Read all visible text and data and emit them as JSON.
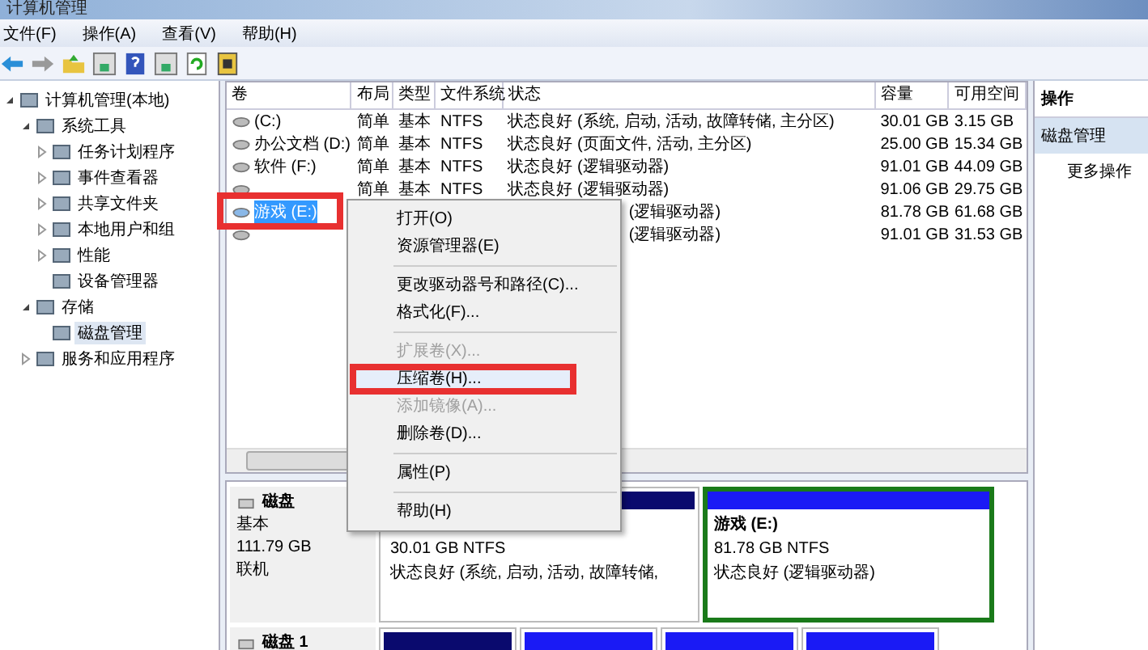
{
  "window": {
    "title": "计算机管理"
  },
  "menu": [
    "文件(F)",
    "操作(A)",
    "查看(V)",
    "帮助(H)"
  ],
  "tree": [
    {
      "label": "计算机管理(本地)",
      "expanded": true,
      "selected": false,
      "children": [
        {
          "label": "系统工具",
          "expanded": true,
          "selected": false,
          "children": [
            {
              "label": "任务计划程序",
              "expanded": false,
              "selected": false
            },
            {
              "label": "事件查看器",
              "expanded": false,
              "selected": false
            },
            {
              "label": "共享文件夹",
              "expanded": false,
              "selected": false
            },
            {
              "label": "本地用户和组",
              "expanded": false,
              "selected": false
            },
            {
              "label": "性能",
              "expanded": false,
              "selected": false
            },
            {
              "label": "设备管理器",
              "selected": false
            }
          ]
        },
        {
          "label": "存储",
          "expanded": true,
          "selected": false,
          "children": [
            {
              "label": "磁盘管理",
              "selected": true
            }
          ]
        },
        {
          "label": "服务和应用程序",
          "expanded": false,
          "selected": false
        }
      ]
    }
  ],
  "table": {
    "columns": [
      "卷",
      "布局",
      "类型",
      "文件系统",
      "状态",
      "容量",
      "可用空间"
    ],
    "rows": [
      {
        "name": "(C:)",
        "layout": "简单",
        "type": "基本",
        "fs": "NTFS",
        "status": "状态良好 (系统, 启动, 活动, 故障转储, 主分区)",
        "capacity": "30.01 GB",
        "free": "3.15 GB",
        "selected": false
      },
      {
        "name": "办公文档 (D:)",
        "layout": "简单",
        "type": "基本",
        "fs": "NTFS",
        "status": "状态良好 (页面文件, 活动, 主分区)",
        "capacity": "25.00 GB",
        "free": "15.34 GB",
        "selected": false
      },
      {
        "name": "软件 (F:)",
        "layout": "简单",
        "type": "基本",
        "fs": "NTFS",
        "status": "状态良好 (逻辑驱动器)",
        "capacity": "91.01 GB",
        "free": "44.09 GB",
        "selected": false
      },
      {
        "layout": "简单",
        "type": "基本",
        "fs": "NTFS",
        "status": "状态良好 (逻辑驱动器)",
        "capacity": "91.06 GB",
        "free": "29.75 GB",
        "selected": false
      },
      {
        "name": "游戏 (E:)",
        "status": "(逻辑驱动器)",
        "capacity": "81.78 GB",
        "free": "61.68 GB",
        "selected": true
      },
      {
        "status": "(逻辑驱动器)",
        "capacity": "91.01 GB",
        "free": "31.53 GB",
        "selected": false
      }
    ]
  },
  "context_menu": [
    {
      "kind": "item",
      "label": "打开(O)",
      "disabled": false,
      "selected": false
    },
    {
      "kind": "item",
      "label": "资源管理器(E)",
      "disabled": false,
      "selected": false
    },
    {
      "kind": "separator"
    },
    {
      "kind": "item",
      "label": "更改驱动器号和路径(C)...",
      "disabled": false,
      "selected": false
    },
    {
      "kind": "item",
      "label": "格式化(F)...",
      "disabled": false,
      "selected": false
    },
    {
      "kind": "separator"
    },
    {
      "kind": "item",
      "label": "扩展卷(X)...",
      "disabled": true,
      "selected": false
    },
    {
      "kind": "item",
      "label": "压缩卷(H)...",
      "disabled": false,
      "selected": true
    },
    {
      "kind": "item",
      "label": "添加镜像(A)...",
      "disabled": true,
      "selected": false
    },
    {
      "kind": "item",
      "label": "删除卷(D)...",
      "disabled": false,
      "selected": false
    },
    {
      "kind": "separator"
    },
    {
      "kind": "item",
      "label": "属性(P)",
      "disabled": false,
      "selected": false
    },
    {
      "kind": "separator"
    },
    {
      "kind": "item",
      "label": "帮助(H)",
      "disabled": false,
      "selected": false
    }
  ],
  "disks": [
    {
      "name": "磁盘",
      "lines": [
        "基本",
        "111.79 GB",
        "联机"
      ],
      "partitions": [
        {
          "size": "30.01 GB NTFS",
          "status": "状态良好 (系统, 启动, 活动, 故障转储,",
          "selected": false,
          "kind": "primary"
        },
        {
          "title": "游戏  (E:)",
          "size": "81.78 GB NTFS",
          "status": "状态良好 (逻辑驱动器)",
          "selected": true,
          "kind": "logical"
        }
      ]
    },
    {
      "name": "磁盘 1",
      "partitions": [
        {
          "kind": "primary",
          "selected": false
        },
        {
          "kind": "logical",
          "selected": false
        },
        {
          "kind": "logical",
          "selected": false
        },
        {
          "kind": "logical",
          "selected": false
        }
      ]
    }
  ],
  "actions": {
    "title": "操作",
    "section": "磁盘管理",
    "items": [
      "更多操作"
    ]
  }
}
